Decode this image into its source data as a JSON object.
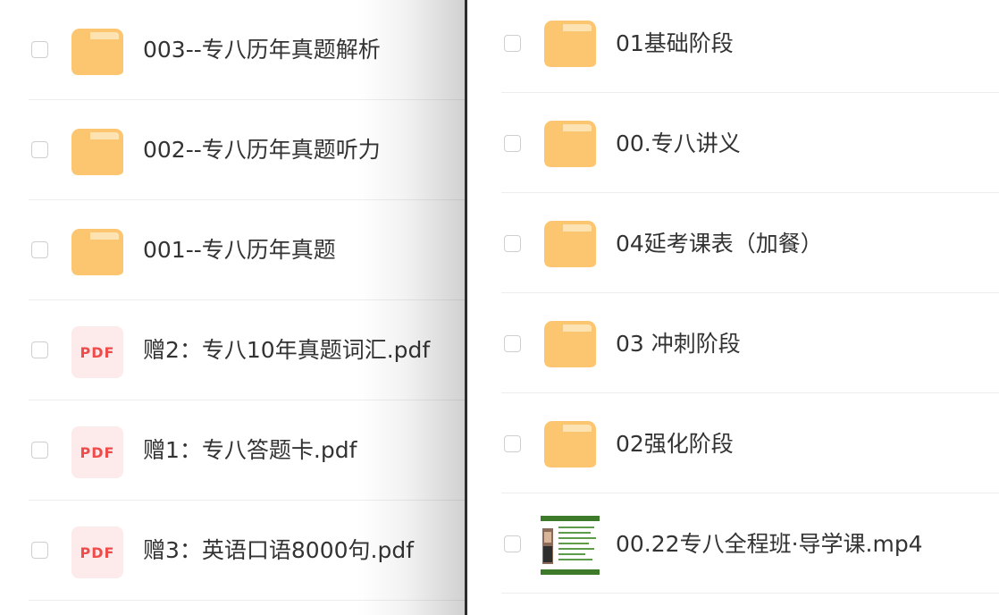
{
  "left_list": {
    "items": [
      {
        "name": "003--专八历年真题解析",
        "type": "folder"
      },
      {
        "name": "002--专八历年真题听力",
        "type": "folder"
      },
      {
        "name": "001--专八历年真题",
        "type": "folder"
      },
      {
        "name": "赠2：专八10年真题词汇.pdf",
        "type": "pdf",
        "icon_label": "PDF"
      },
      {
        "name": "赠1：专八答题卡.pdf",
        "type": "pdf",
        "icon_label": "PDF"
      },
      {
        "name": "赠3：英语口语8000句.pdf",
        "type": "pdf",
        "icon_label": "PDF"
      }
    ]
  },
  "right_list": {
    "items": [
      {
        "name": "01基础阶段",
        "type": "folder"
      },
      {
        "name": "00.专八讲义",
        "type": "folder"
      },
      {
        "name": "04延考课表（加餐）",
        "type": "folder"
      },
      {
        "name": "03 冲刺阶段",
        "type": "folder"
      },
      {
        "name": "02强化阶段",
        "type": "folder"
      },
      {
        "name": "00.22专八全程班·导学课.mp4",
        "type": "video"
      }
    ]
  },
  "colors": {
    "folder_body": "#fcc670",
    "folder_tab": "#fde3b2",
    "pdf_bg": "#fdeaea",
    "pdf_text": "#f04b4b",
    "text": "#333333",
    "separator": "#ededed",
    "divider": "#2c2c2c"
  },
  "icons": {
    "folder": "folder-icon",
    "pdf": "pdf-file-icon",
    "video": "video-thumbnail-icon"
  }
}
